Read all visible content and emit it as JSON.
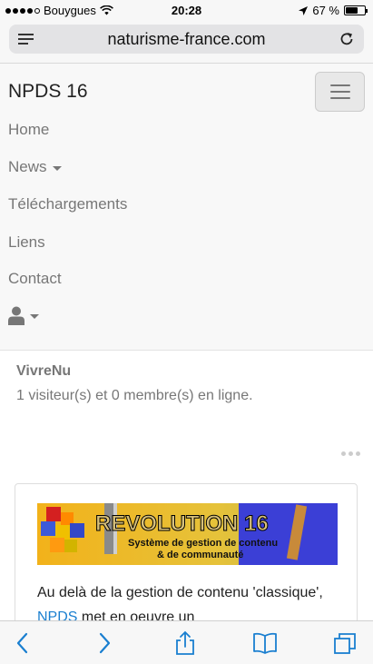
{
  "status_bar": {
    "carrier": "Bouygues",
    "time": "20:28",
    "battery": "67 %",
    "battery_level": 0.67
  },
  "browser": {
    "url": "naturisme-france.com"
  },
  "navbar": {
    "brand": "NPDS  16",
    "items": [
      {
        "label": "Home"
      },
      {
        "label": "News"
      },
      {
        "label": "Téléchargements"
      },
      {
        "label": "Liens"
      },
      {
        "label": "Contact"
      }
    ]
  },
  "online_block": {
    "title": "VivreNu",
    "text": "1 visiteur(s) et 0 membre(s) en ligne."
  },
  "card": {
    "banner_title": "REVOLUTION 16",
    "banner_line1": "Système de gestion de contenu",
    "banner_line2": "& de communauté",
    "text_before": "Au delà de la gestion de contenu 'classique', ",
    "link": "NPDS",
    "text_after": " met en oeuvre un"
  },
  "colors": {
    "link": "#1a7fd0",
    "nav_text": "#777777",
    "navbar_bg": "#f8f8f8"
  }
}
